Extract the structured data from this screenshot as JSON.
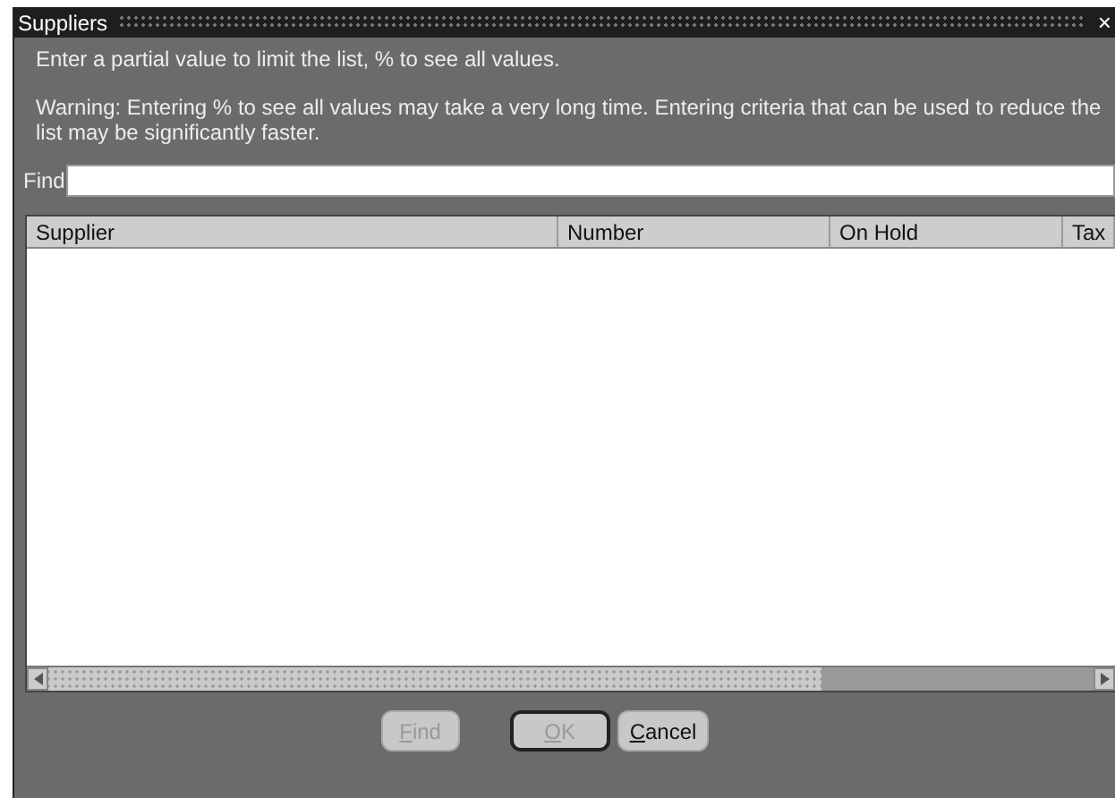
{
  "window": {
    "title": "Suppliers",
    "close": "×"
  },
  "instructions": [
    "Enter a partial value to limit the list, % to see all values.",
    "Warning: Entering % to see all values may take a very long time. Entering criteria that can be used to reduce the list may be significantly faster."
  ],
  "find": {
    "label": "Find"
  },
  "table": {
    "columns": [
      "Supplier",
      "Number",
      "On Hold",
      "Tax"
    ]
  },
  "buttons": [
    {
      "mnemonic": "F",
      "rest": "ind",
      "disabled": true,
      "default": false
    },
    {
      "mnemonic": "O",
      "rest": "K",
      "disabled": true,
      "default": true
    },
    {
      "mnemonic": "C",
      "rest": "ancel",
      "disabled": false,
      "default": false
    }
  ]
}
